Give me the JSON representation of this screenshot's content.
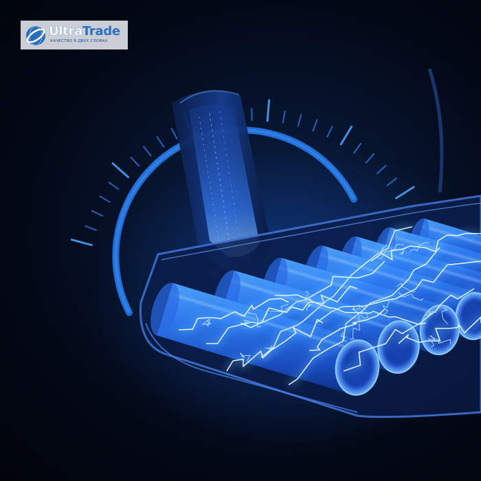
{
  "brand": {
    "name_part1": "Ultra",
    "name_part2": "Trade",
    "tagline": "КАЧЕСТВО В ДВУХ СЛОВАХ"
  },
  "image": {
    "subject": "glowing battery pack with electric arcs inside a transparent handle, with a circular power gauge behind",
    "colors": {
      "background": "#020611",
      "glow": "#1e6cff",
      "cell": "#1f63e0",
      "arc": "#cfeeff"
    }
  }
}
